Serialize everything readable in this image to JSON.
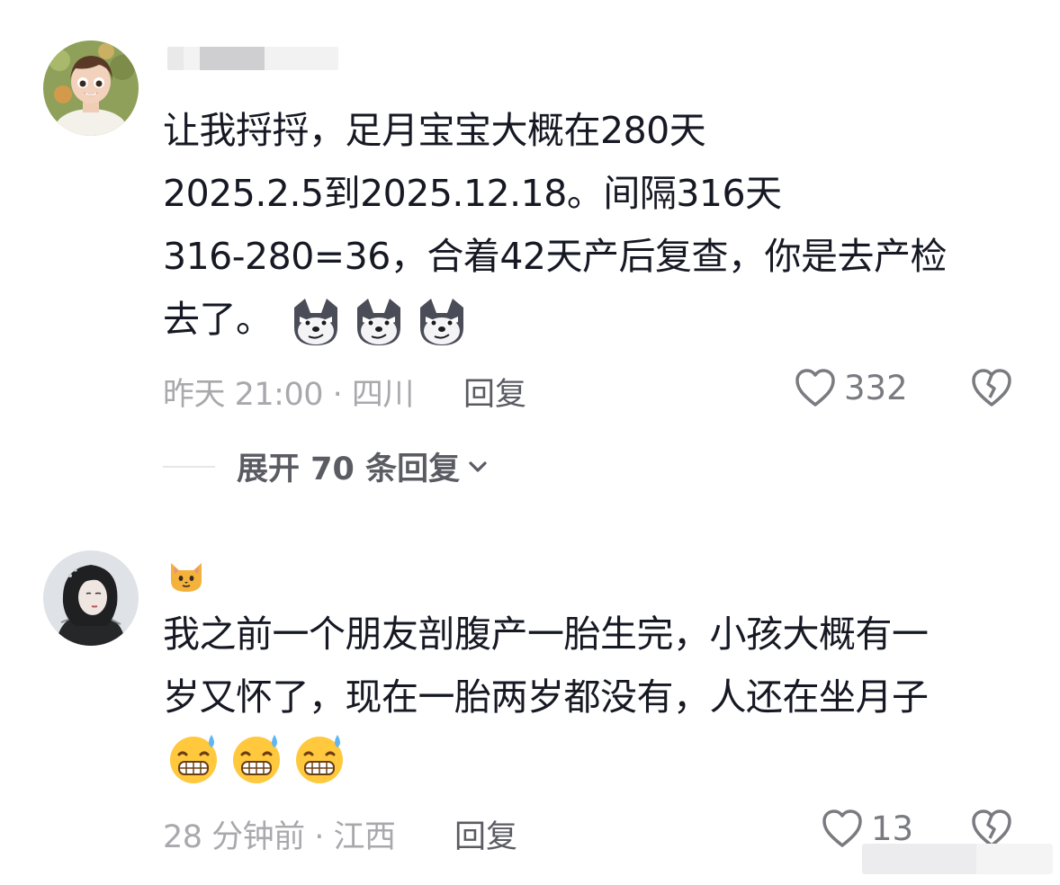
{
  "comments": [
    {
      "username_visible": false,
      "text_lines": [
        "让我捋捋，足月宝宝大概在280天",
        "2025.2.5到2025.12.18。间隔316天",
        "316-280=36，合着42天产后复查，你是去产检",
        "去了。"
      ],
      "emojis": [
        "wolf-smirk-emoji",
        "wolf-smirk-emoji",
        "wolf-smirk-emoji"
      ],
      "time_location": "昨天 21:00 · 四川",
      "reply_label": "回复",
      "like_count": "332",
      "expand_label": "展开 70 条回复"
    },
    {
      "username_emoji": "cat-face-emoji",
      "text_lines": [
        "我之前一个朋友剖腹产一胎生完，小孩大概有一",
        "岁又怀了，现在一胎两岁都没有，人还在坐月子"
      ],
      "emojis": [
        "sweat-grin-emoji",
        "sweat-grin-emoji",
        "sweat-grin-emoji"
      ],
      "time_location": "28 分钟前 · 江西",
      "reply_label": "回复",
      "like_count": "13"
    }
  ],
  "colors": {
    "text": "#161823",
    "meta": "#a9a9ad",
    "action": "#5b5c63",
    "icon": "#7a7b80"
  }
}
